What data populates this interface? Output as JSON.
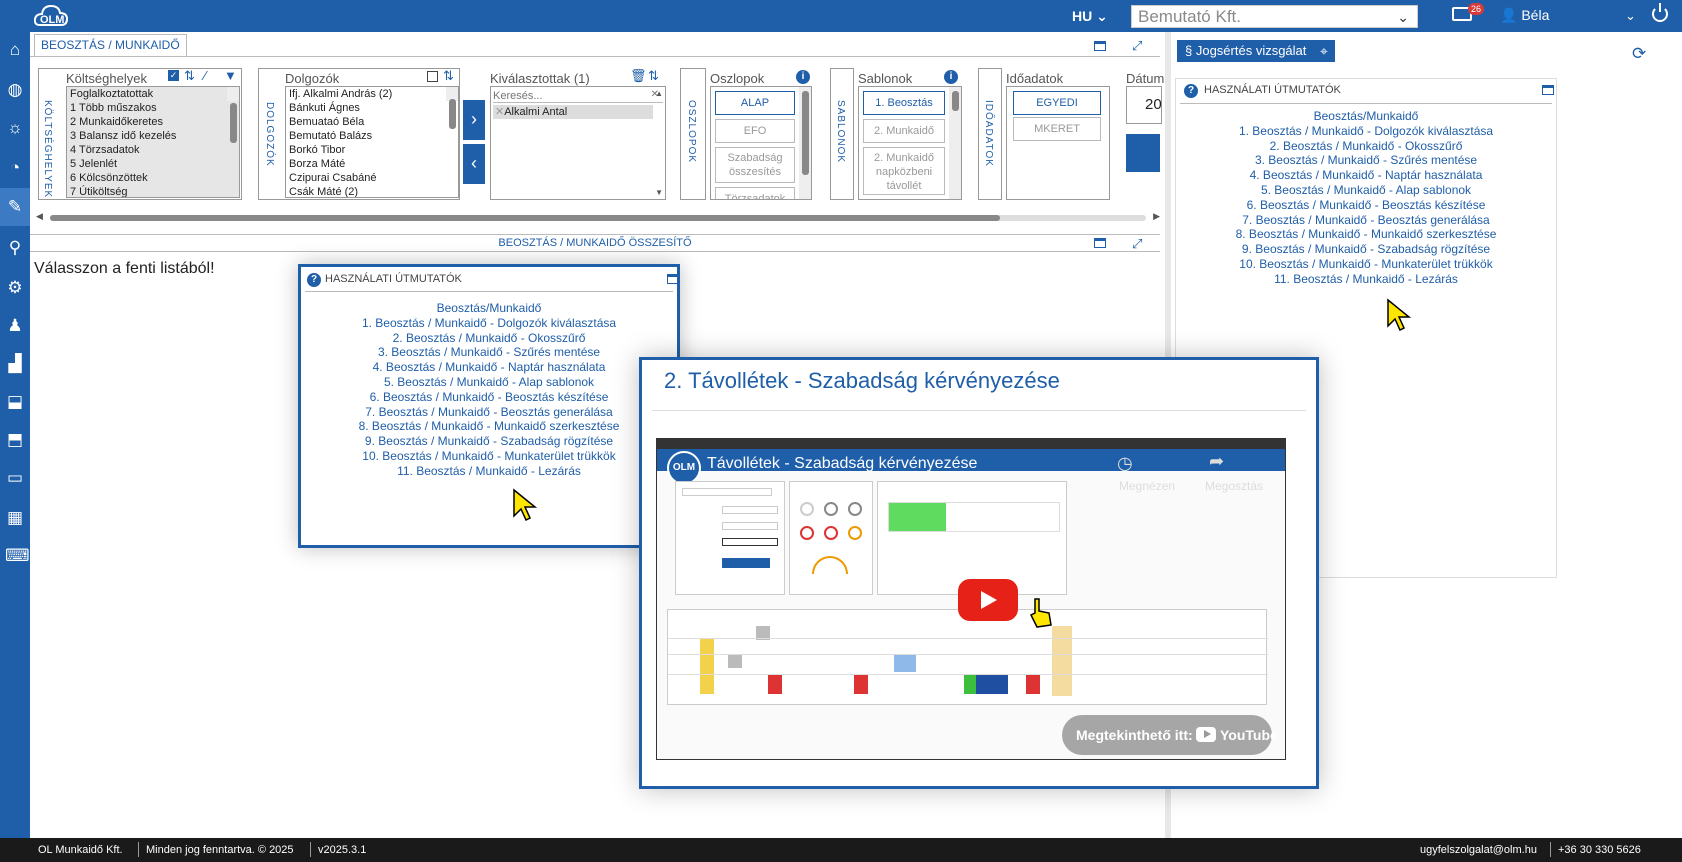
{
  "header": {
    "logo_text": "OLM",
    "language": "HU",
    "company": "Bemutató Kft.",
    "mail_count": "26",
    "user_name": "Béla"
  },
  "sidebar_icons": [
    "home-icon",
    "globe-icon",
    "sun-icon",
    "clock-icon",
    "tools-icon",
    "satellite-icon",
    "gears-icon",
    "users-icon",
    "factory-icon",
    "inbox-icon",
    "inbox-settings-icon",
    "folder-icon",
    "calendar-icon",
    "keyboard-icon"
  ],
  "panel": {
    "tab_label": "BEOSZTÁS / MUNKAIDŐ",
    "cost_centers": {
      "vertical_label": "KÖLTSÉGHELYEK",
      "title": "Költséghelyek",
      "items": [
        "Foglalkoztatottak",
        "1 Több műszakos",
        "2 Munkaidőkeretes",
        "3 Balansz idő kezelés",
        "4 Törzsadatok",
        "5 Jelenlét",
        "6 Kölcsönzöttek",
        "7 Útiköltség"
      ]
    },
    "employees": {
      "vertical_label": "DOLGOZÓK",
      "title": "Dolgozók",
      "items": [
        "Ifj. Alkalmi András (2)",
        "Bánkuti Ágnes",
        "Bemuataó Béla",
        "Bemutató Balázs",
        "Borkó Tibor",
        "Borza Máté",
        "Czipurai Csabáné",
        "Csák Máté (2)"
      ]
    },
    "selected": {
      "title": "Kiválasztottak (1)",
      "search_placeholder": "Keresés...",
      "items": [
        "Alkalmi Antal"
      ]
    },
    "columns": {
      "vertical_label": "OSZLOPOK",
      "title": "Oszlopok",
      "buttons": [
        "ALAP",
        "EFO",
        "Szabadság összesítés",
        "Törzsadatok"
      ]
    },
    "templates": {
      "vertical_label": "SABLONOK",
      "title": "Sablonok",
      "buttons": [
        "1. Beosztás",
        "2. Munkaidő",
        "2. Munkaidő napközbeni távollét"
      ]
    },
    "time_data": {
      "vertical_label": "IDŐADATOK",
      "title": "Időadatok",
      "buttons": [
        "EGYEDI",
        "MKERET"
      ]
    },
    "date_title": "Dátum",
    "date_value": "20",
    "summary_title": "BEOSZTÁS / MUNKAIDŐ ÖSSZESÍTŐ",
    "choose_text": "Válasszon a fenti listából!"
  },
  "guide": {
    "title": "HASZNÁLATI ÚTMUTATÓK",
    "links": [
      "Beosztás/Munkaidő",
      "1. Beosztás / Munkaidő - Dolgozók kiválasztása",
      "2. Beosztás / Munkaidő - Okosszűrő",
      "3. Beosztás / Munkaidő - Szűrés mentése",
      "4. Beosztás / Munkaidő - Naptár használata",
      "5. Beosztás / Munkaidő - Alap sablonok",
      "6. Beosztás / Munkaidő - Beosztás készítése",
      "7. Beosztás / Munkaidő - Beosztás generálása",
      "8. Beosztás / Munkaidő - Munkaidő szerkesztése",
      "9. Beosztás / Munkaidő - Szabadság rögzítése",
      "10. Beosztás / Munkaidő - Munkaterület trükkök",
      "11. Beosztás / Munkaidő - Lezárás"
    ]
  },
  "right_pane": {
    "jog_button": "Jogsértés vizsgálat",
    "guide_title": "HASZNÁLATI ÚTMUTATÓK",
    "links": [
      "Beosztás/Munkaidő",
      "1. Beosztás / Munkaidő - Dolgozók kiválasztása",
      "2. Beosztás / Munkaidő - Okosszűrő",
      "3. Beosztás / Munkaidő - Szűrés mentése",
      "4. Beosztás / Munkaidő - Naptár használata",
      "5. Beosztás / Munkaidő - Alap sablonok",
      "6. Beosztás / Munkaidő - Beosztás készítése",
      "7. Beosztás / Munkaidő - Beosztás generálása",
      "8. Beosztás / Munkaidő - Munkaidő szerkesztése",
      "9. Beosztás / Munkaidő - Szabadság rögzítése",
      "10. Beosztás / Munkaidő - Munkaterület trükkök",
      "11. Beosztás / Munkaidő - Lezárás"
    ]
  },
  "video": {
    "card_title": "2. Távollétek - Szabadság kérvényezése",
    "video_heading": "Távollétek - Szabadság kérvényezése",
    "watch_later": "Megnézen",
    "share": "Megosztás",
    "watch_on": "Megtekinthető itt:",
    "youtube": "YouTube"
  },
  "footer": {
    "company": "OL Munkaidő Kft.",
    "rights": "Minden jog fenntartva. © 2025",
    "version": "v2025.3.1",
    "email": "ugyfelszolgalat@olm.hu",
    "phone": "+36 30 330 5626"
  },
  "colors": {
    "primary": "#1f5ea8",
    "accent_red": "#e62117",
    "footer": "#1a1a1a"
  }
}
